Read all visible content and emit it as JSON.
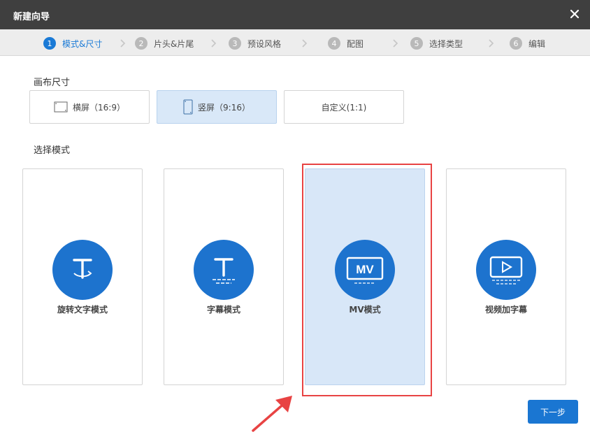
{
  "window": {
    "title": "新建向导"
  },
  "steps": [
    {
      "num": "1",
      "label": "模式&尺寸",
      "active": true
    },
    {
      "num": "2",
      "label": "片头&片尾"
    },
    {
      "num": "3",
      "label": "预设风格"
    },
    {
      "num": "4",
      "label": "配图"
    },
    {
      "num": "5",
      "label": "选择类型"
    },
    {
      "num": "6",
      "label": "编辑"
    }
  ],
  "canvas": {
    "label": "画布尺寸",
    "options": [
      {
        "label": "横屏（16:9）",
        "icon": "landscape-screen-icon"
      },
      {
        "label": "竖屏（9:16）",
        "icon": "portrait-screen-icon",
        "selected": true
      },
      {
        "label": "自定义(1:1)"
      }
    ]
  },
  "modes": {
    "label": "选择模式",
    "items": [
      {
        "label": "旋转文字模式",
        "icon": "rotate-text-icon"
      },
      {
        "label": "字幕模式",
        "icon": "subtitle-text-icon"
      },
      {
        "label": "MV模式",
        "icon": "mv-icon",
        "icon_text": "MV",
        "selected": true
      },
      {
        "label": "视频加字幕",
        "icon": "video-subtitle-icon"
      }
    ]
  },
  "footer": {
    "next_label": "下一步"
  },
  "colors": {
    "accent": "#1a76d2",
    "highlight": "#e84343",
    "titlebar": "#3f3f3f"
  }
}
